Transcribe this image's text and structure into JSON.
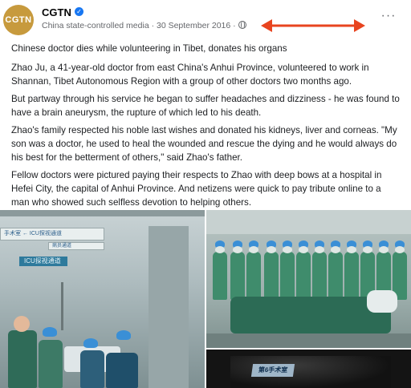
{
  "post": {
    "avatar_text": "CGTN",
    "page_name": "CGTN",
    "verified_mark": "✓",
    "meta": "China state-controlled media · 30 September 2016 ·",
    "more_label": "···",
    "icons": {
      "verified": "verified-badge-icon",
      "privacy": "globe-icon",
      "more": "more-options-icon",
      "annotation": "double-headed-arrow-icon"
    },
    "annotation_color": "#e8441f"
  },
  "content": {
    "headline": "Chinese doctor dies while volunteering in Tibet, donates his organs",
    "p1": "Zhao Ju, a 41-year-old doctor from east China's Anhui Province, volunteered to work in Shannan, Tibet Autonomous Region with a group of other doctors two months ago.",
    "p2": "But partway through his service he began to suffer headaches and dizziness - he was found to have a brain aneurysm, the rupture of which led to his death.",
    "p3": "Zhao's family respected his noble last wishes and donated his kidneys, liver and corneas. \"My son was a doctor, he used to heal the wounded and rescue the dying and he would always do his best for the betterment of others,\" said Zhao's father.",
    "p4": "Fellow doctors were pictured paying their respects to Zhao with deep bows at a hospital in Hefei City, the capital of Anhui Province. And netizens were quick to pay tribute online to a man who showed such selfless devotion to helping others."
  },
  "photos": {
    "left_sign_1": "手术室 ← ICU探视通道",
    "left_sign_2": "病员通道",
    "left_icu_sign": "ICU探视通道",
    "bottom_right_plaque": "第6手术室"
  }
}
